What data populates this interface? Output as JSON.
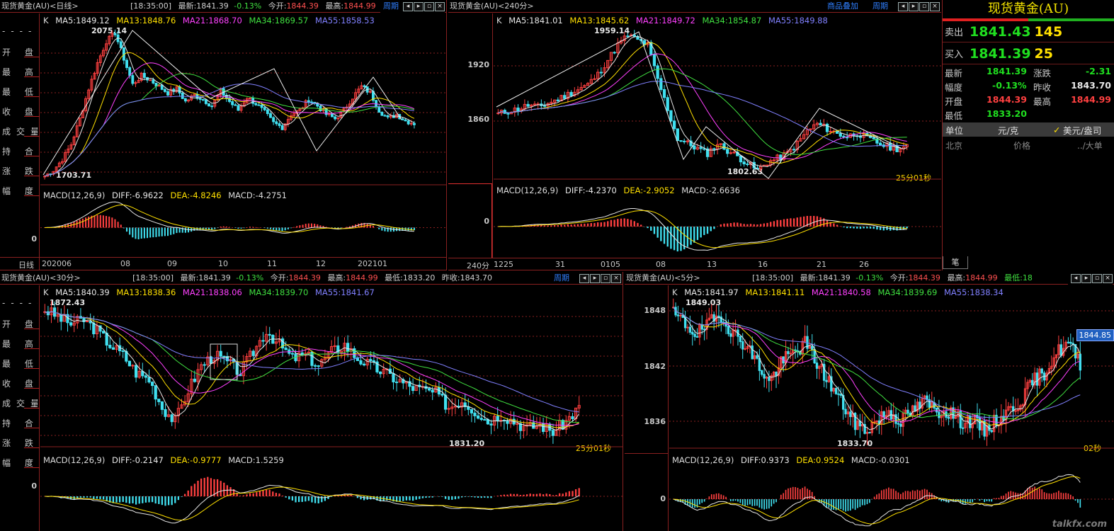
{
  "colors": {
    "up": "#ff4040",
    "down": "#40e0f0",
    "ma5": "#e8e8e8",
    "ma13": "#ffe000",
    "ma21": "#ff40ff",
    "ma34": "#40e040",
    "ma55": "#8080ff",
    "accent": "#8a2020"
  },
  "left_labels": [
    "------",
    "开 盘",
    "最 高",
    "最 低",
    "收 盘",
    "成交量",
    "持 合",
    "涨 跌",
    "幅 度"
  ],
  "panel_daily": {
    "title": "现货黄金(AU)<日线>",
    "buttons": [
      "周期"
    ],
    "ma": {
      "ma5": "MA5:1849.12",
      "ma13": "MA13:1848.76",
      "ma21": "MA21:1868.70",
      "ma34": "MA34:1869.57",
      "ma55": "MA55:1858.53"
    },
    "k_label": "K",
    "high_label": "2075.14",
    "low_label": "1703.71",
    "macd": {
      "name": "MACD(12,26,9)",
      "diff": "DIFF:-6.9622",
      "dea": "DEA:-4.8246",
      "macd": "MACD:-4.2751"
    },
    "macd_zero": "0",
    "period_label": "日线",
    "dates": [
      "202006",
      "08",
      "09",
      "10",
      "11",
      "12",
      "202101"
    ],
    "series": {
      "closes": [
        1726,
        1740,
        1765,
        1800,
        1860,
        1930,
        1990,
        2040,
        2060,
        2000,
        1940,
        1960,
        1950,
        1935,
        1920,
        1930,
        1900,
        1915,
        1905,
        1890,
        1925,
        1900,
        1880,
        1910,
        1895,
        1875,
        1850,
        1840,
        1870,
        1880,
        1905,
        1890,
        1870,
        1860,
        1880,
        1910,
        1935,
        1920,
        1880,
        1860,
        1870,
        1855,
        1849
      ]
    }
  },
  "panel_240": {
    "title": "现货黄金(AU)<240分>",
    "buttons": [
      "商品叠加",
      "周期"
    ],
    "ma": {
      "ma5": "MA5:1841.01",
      "ma13": "MA13:1845.62",
      "ma21": "MA21:1849.72",
      "ma34": "MA34:1854.87",
      "ma55": "MA55:1849.88"
    },
    "k_label": "K",
    "y_labels": [
      "1920",
      "1860"
    ],
    "high_label": "1959.14",
    "low_label": "1802.63",
    "clock": "25分01秒",
    "macd": {
      "name": "MACD(12,26,9)",
      "diff": "DIFF:-4.2370",
      "dea": "DEA:-2.9052",
      "macd": "MACD:-2.6636"
    },
    "macd_zero": "0",
    "period_label": "240分",
    "dates": [
      "1225",
      "31",
      "0105",
      "08",
      "13",
      "16",
      "21",
      "26"
    ],
    "series": {
      "closes": [
        1875,
        1878,
        1880,
        1884,
        1882,
        1886,
        1890,
        1895,
        1900,
        1905,
        1915,
        1930,
        1945,
        1955,
        1950,
        1945,
        1910,
        1880,
        1850,
        1845,
        1840,
        1835,
        1845,
        1838,
        1832,
        1825,
        1818,
        1826,
        1830,
        1835,
        1845,
        1858,
        1865,
        1860,
        1855,
        1852,
        1856,
        1850,
        1846,
        1842,
        1840,
        1841
      ]
    }
  },
  "panel_30": {
    "title": "现货黄金(AU)<30分>",
    "quote_line": {
      "time": "[18:35:00]",
      "last": "最新:1841.39",
      "change": "-0.13%",
      "open_lbl": "今开:",
      "open": "1844.39",
      "high_lbl": "最高:",
      "high": "1844.99",
      "low": "最低:1833.20",
      "prev": "昨收:1843.70"
    },
    "buttons": [
      "周期"
    ],
    "ma": {
      "ma5": "MA5:1840.39",
      "ma13": "MA13:1838.36",
      "ma21": "MA21:1838.06",
      "ma34": "MA34:1839.70",
      "ma55": "MA55:1841.67"
    },
    "k_label": "K",
    "high_label": "1872.43",
    "low_label": "1831.20",
    "clock": "25分01秒",
    "macd": {
      "name": "MACD(12,26,9)",
      "diff": "DIFF:-0.2147",
      "dea": "DEA:-0.9777",
      "macd": "MACD:1.5259"
    },
    "macd_zero": "0",
    "series": {
      "closes": [
        1868,
        1866,
        1864,
        1865,
        1862,
        1858,
        1855,
        1850,
        1848,
        1840,
        1836,
        1845,
        1852,
        1855,
        1853,
        1850,
        1856,
        1862,
        1858,
        1854,
        1855,
        1852,
        1856,
        1858,
        1854,
        1852,
        1850,
        1848,
        1846,
        1845,
        1844,
        1840,
        1842,
        1839,
        1836,
        1838,
        1836,
        1834,
        1835,
        1833,
        1836,
        1840
      ]
    }
  },
  "panel_5": {
    "title": "现货黄金(AU)<5分>",
    "quote_line": {
      "time": "[18:35:00]",
      "last": "最新:1841.39",
      "change": "-0.13%",
      "open_lbl": "今开:",
      "open": "1844.39",
      "high_lbl": "最高:",
      "high": "1844.99",
      "low": "最低:18"
    },
    "ma": {
      "ma5": "MA5:1841.97",
      "ma13": "MA13:1841.11",
      "ma21": "MA21:1840.58",
      "ma34": "MA34:1839.69",
      "ma55": "MA55:1838.34"
    },
    "k_label": "K",
    "y_labels": [
      "1848",
      "1842",
      "1836"
    ],
    "high_label": "1849.03",
    "low_label": "1833.70",
    "price_tag": "1844.85",
    "clock": "02秒",
    "macd": {
      "name": "MACD(12,26,9)",
      "diff": "DIFF:0.9373",
      "dea": "DEA:0.9524",
      "macd": "MACD:-0.0301"
    },
    "macd_zero": "0",
    "series": {
      "closes": [
        1847,
        1846,
        1845,
        1846,
        1847,
        1845,
        1844,
        1842,
        1840,
        1842,
        1843,
        1844,
        1842,
        1840,
        1838,
        1836,
        1835,
        1836,
        1837,
        1836,
        1837,
        1838,
        1837,
        1837,
        1836,
        1836,
        1835,
        1836,
        1837,
        1838,
        1840,
        1841,
        1843,
        1844,
        1842
      ]
    }
  },
  "quote": {
    "title": "现货黄金(AU)",
    "sell_label": "卖出",
    "sell_price": "1841.43",
    "sell_vol": "145",
    "buy_label": "买入",
    "buy_price": "1841.39",
    "buy_vol": "25",
    "rows": [
      {
        "l1": "最新",
        "v1": "1841.39",
        "l2": "涨跌",
        "v2": "-2.31"
      },
      {
        "l1": "幅度",
        "v1": "-0.13%",
        "l2": "昨收",
        "v2": "1843.70"
      },
      {
        "l1": "开盘",
        "v1": "1844.39",
        "l2": "最高",
        "v2": "1844.99"
      },
      {
        "l1": "最低",
        "v1": "1833.20",
        "l2": "",
        "v2": ""
      }
    ],
    "unit_label": "单位",
    "unit_value": "元/克",
    "unit_alt": "美元/盎司",
    "hdr_place": "北京",
    "hdr_price": "价格",
    "hdr_vol": "../大单",
    "bottom_tab": "笔"
  },
  "watermark": "talkfx.com"
}
